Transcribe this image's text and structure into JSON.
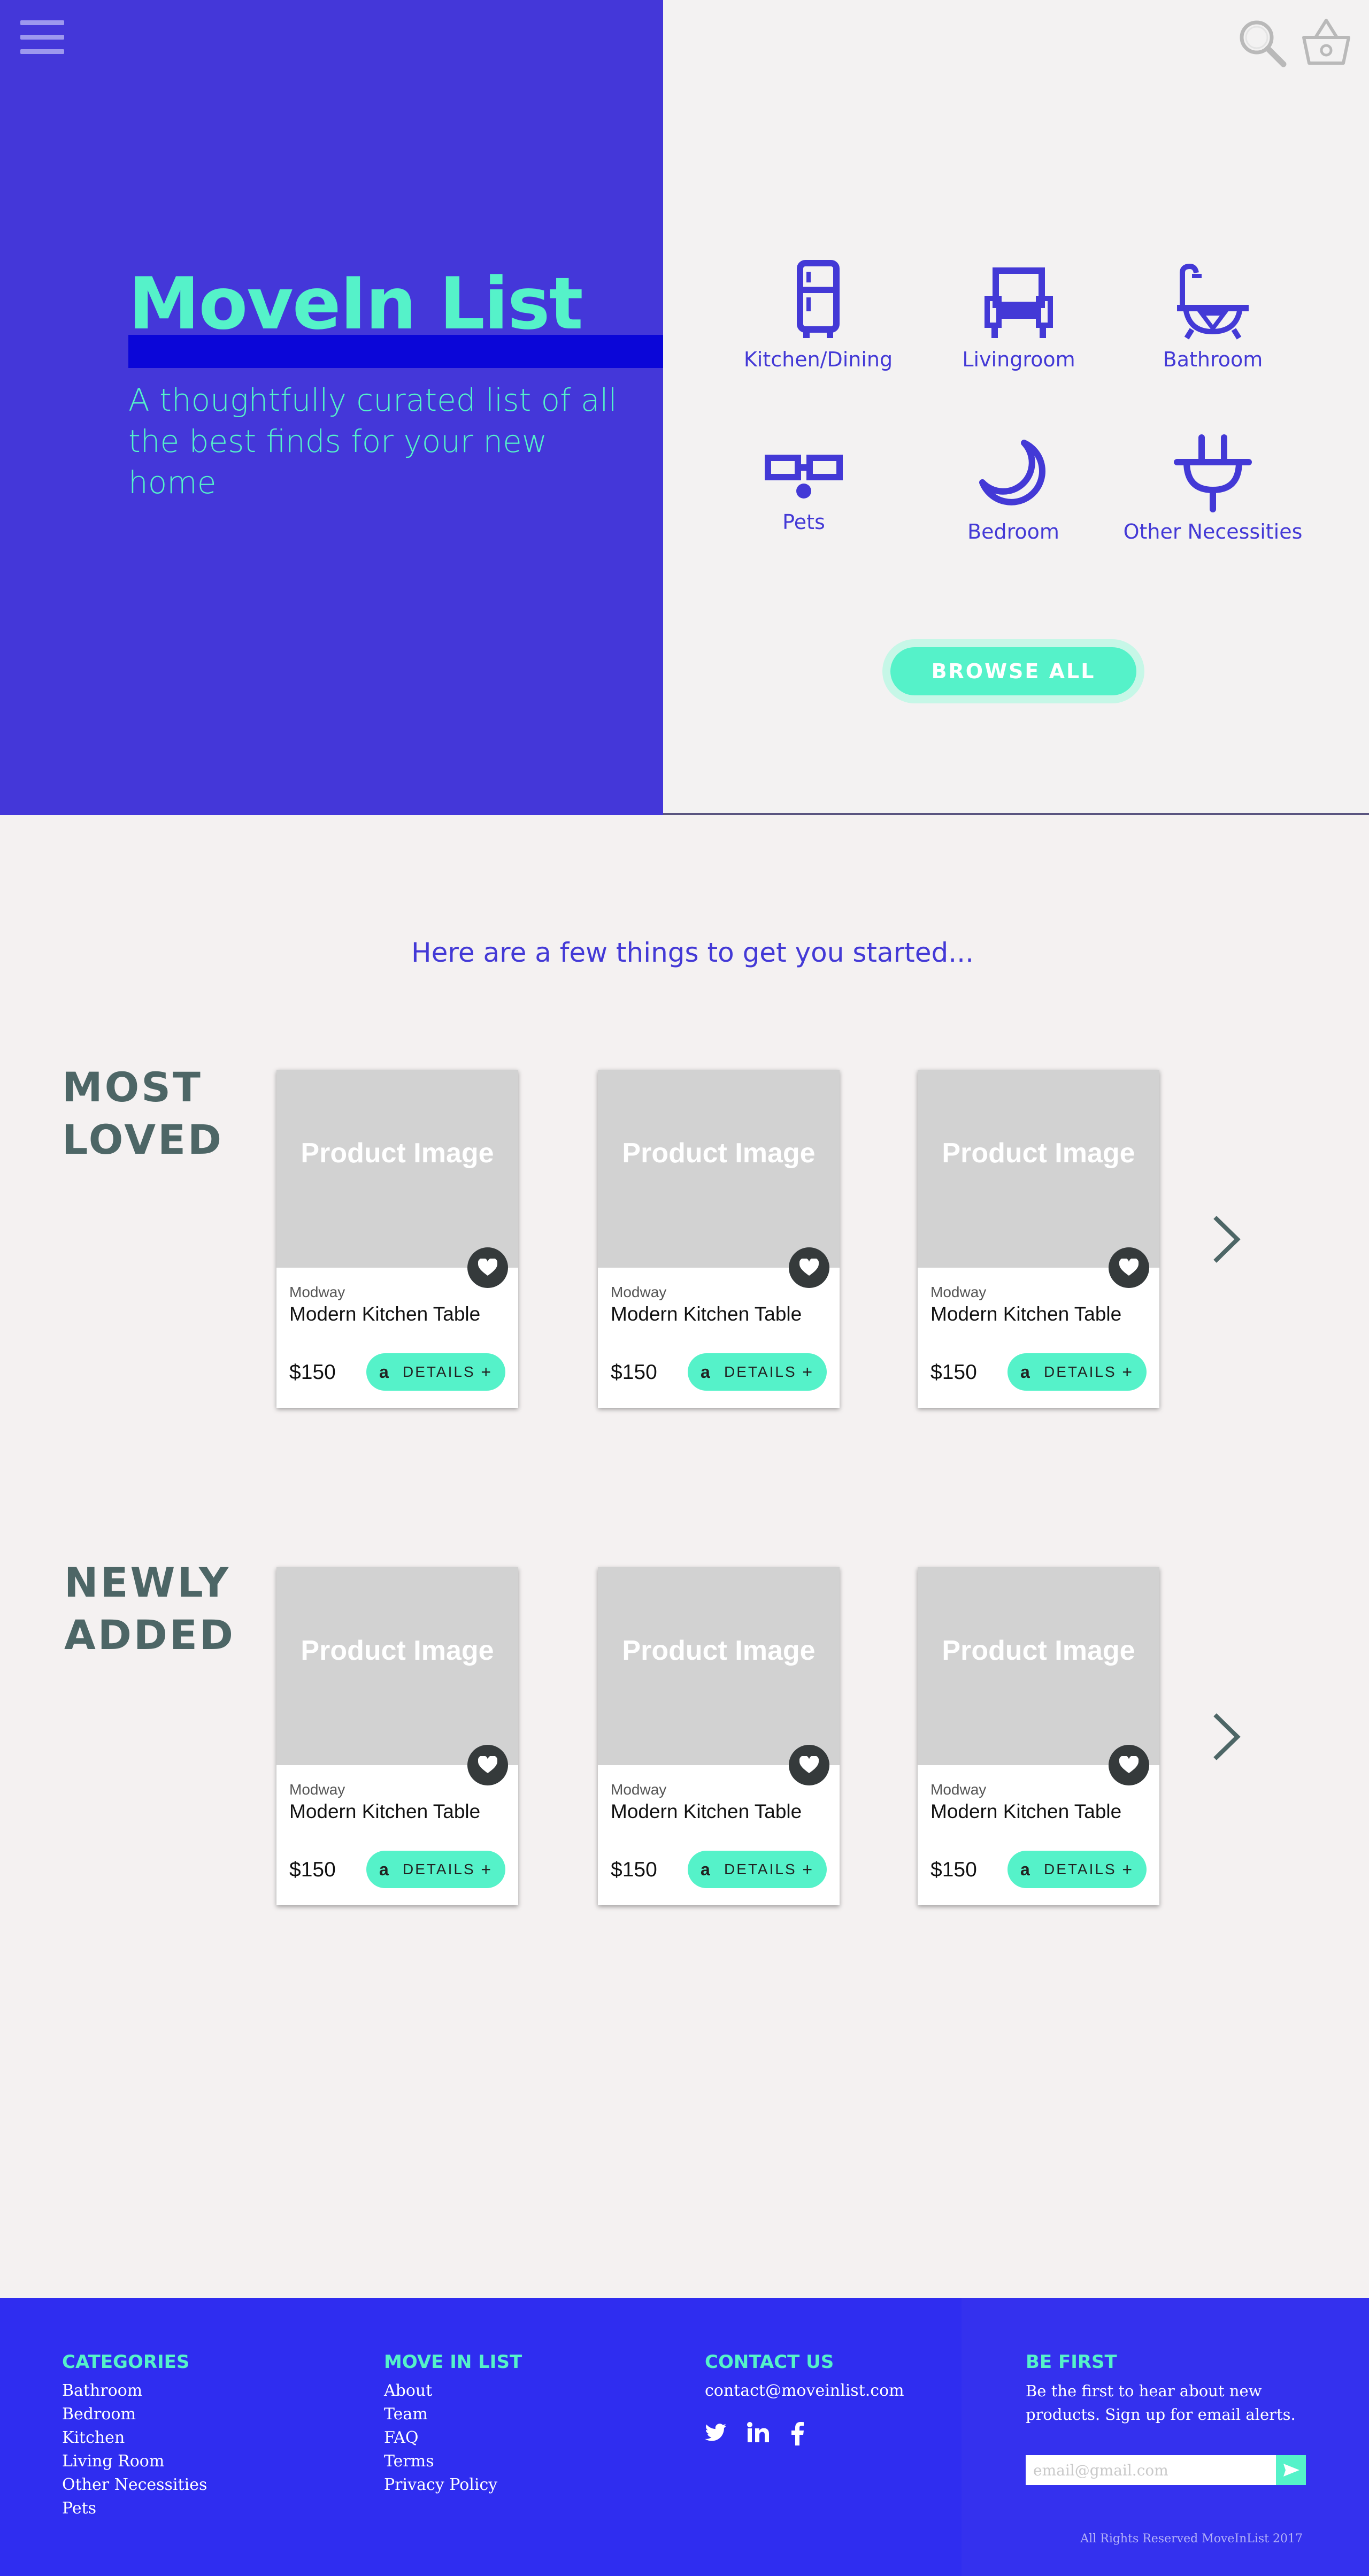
{
  "hero": {
    "title": "MoveIn List",
    "subtitle": "A thoughtfully curated list of all the best finds for your new home"
  },
  "header": {
    "icons": [
      "hamburger-menu-icon",
      "search-icon",
      "basket-icon"
    ]
  },
  "categories": [
    {
      "label": "Kitchen/Dining",
      "icon": "fridge-icon"
    },
    {
      "label": "Livingroom",
      "icon": "armchair-icon"
    },
    {
      "label": "Bathroom",
      "icon": "bathtub-icon"
    },
    {
      "label": "Pets",
      "icon": "pet-bowl-icon"
    },
    {
      "label": "Bedroom",
      "icon": "moon-icon"
    },
    {
      "label": "Other Necessities",
      "icon": "plug-icon"
    }
  ],
  "browse_all": "BROWSE ALL",
  "tagline": "Here are a few things to get you started...",
  "sections": [
    {
      "title_line1": "MOST",
      "title_line2": "LOVED",
      "products": [
        {
          "image_text": "Product Image",
          "brand": "Modway",
          "name": "Modern Kitchen Table",
          "price": "$150",
          "button": "DETAILS",
          "amazon": "a",
          "plus": "+"
        },
        {
          "image_text": "Product Image",
          "brand": "Modway",
          "name": "Modern Kitchen Table",
          "price": "$150",
          "button": "DETAILS",
          "amazon": "a",
          "plus": "+"
        },
        {
          "image_text": "Product Image",
          "brand": "Modway",
          "name": "Modern Kitchen Table",
          "price": "$150",
          "button": "DETAILS",
          "amazon": "a",
          "plus": "+"
        }
      ]
    },
    {
      "title_line1": "NEWLY",
      "title_line2": "ADDED",
      "products": [
        {
          "image_text": "Product Image",
          "brand": "Modway",
          "name": "Modern Kitchen Table",
          "price": "$150",
          "button": "DETAILS",
          "amazon": "a",
          "plus": "+"
        },
        {
          "image_text": "Product Image",
          "brand": "Modway",
          "name": "Modern Kitchen Table",
          "price": "$150",
          "button": "DETAILS",
          "amazon": "a",
          "plus": "+"
        },
        {
          "image_text": "Product Image",
          "brand": "Modway",
          "name": "Modern Kitchen Table",
          "price": "$150",
          "button": "DETAILS",
          "amazon": "a",
          "plus": "+"
        }
      ]
    }
  ],
  "footer": {
    "categories": {
      "heading": "CATEGORIES",
      "links": [
        "Bathroom",
        "Bedroom",
        "Kitchen",
        "Living Room",
        "Other Necessities",
        "Pets"
      ]
    },
    "move_in_list": {
      "heading": "MOVE IN LIST",
      "links": [
        "About",
        "Team",
        "FAQ",
        "Terms",
        "Privacy Policy"
      ]
    },
    "contact": {
      "heading": "CONTACT US",
      "email": "contact@moveinlist.com",
      "social": [
        "twitter-icon",
        "linkedin-icon",
        "facebook-icon"
      ]
    },
    "be_first": {
      "heading": "BE FIRST",
      "text": "Be the first to hear about new products. Sign up for email alerts.",
      "placeholder": "email@gmail.com"
    },
    "copyright": "All Rights Reserved  MoveInList 2017"
  },
  "colors": {
    "hero_blue": "#4437d9",
    "accent_mint": "#55f2c9",
    "footer_blue": "#2f2df0",
    "section_title": "#4d6666"
  }
}
